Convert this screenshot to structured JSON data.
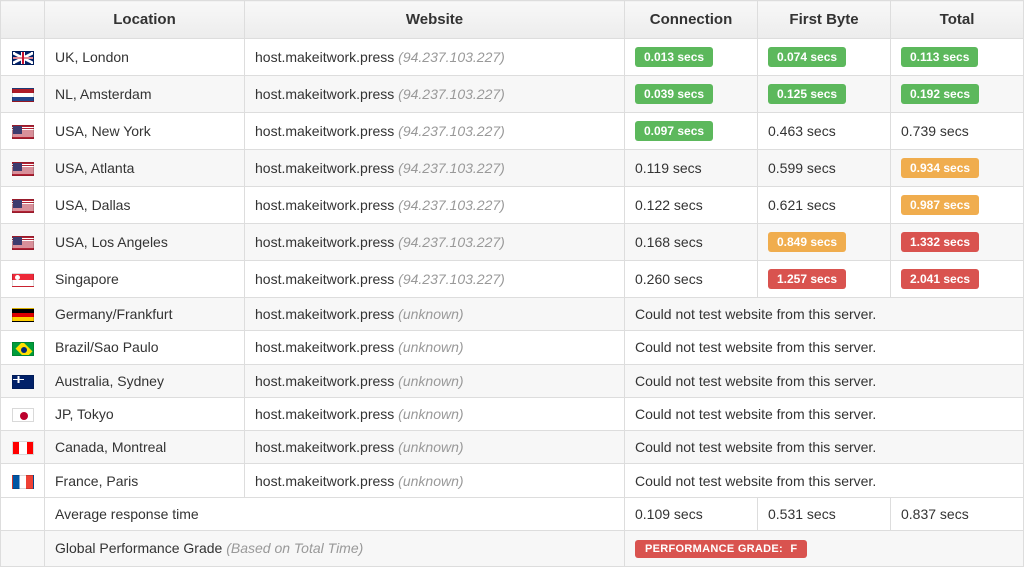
{
  "columns": {
    "flag": "",
    "location": "Location",
    "website": "Website",
    "connection": "Connection",
    "first_byte": "First Byte",
    "total": "Total"
  },
  "host": "host.makeitwork.press",
  "ip_known": "(94.237.103.227)",
  "ip_unknown": "(unknown)",
  "error_text": "Could not test website from this server.",
  "rows": [
    {
      "flag": "uk",
      "location": "UK, London",
      "ip": "known",
      "conn": {
        "v": "0.013 secs",
        "c": "green"
      },
      "fb": {
        "v": "0.074 secs",
        "c": "green"
      },
      "tot": {
        "v": "0.113 secs",
        "c": "green"
      }
    },
    {
      "flag": "nl",
      "location": "NL, Amsterdam",
      "ip": "known",
      "conn": {
        "v": "0.039 secs",
        "c": "green"
      },
      "fb": {
        "v": "0.125 secs",
        "c": "green"
      },
      "tot": {
        "v": "0.192 secs",
        "c": "green"
      }
    },
    {
      "flag": "us",
      "location": "USA, New York",
      "ip": "known",
      "conn": {
        "v": "0.097 secs",
        "c": "green"
      },
      "fb": {
        "v": "0.463 secs",
        "c": "plain"
      },
      "tot": {
        "v": "0.739 secs",
        "c": "plain"
      }
    },
    {
      "flag": "us",
      "location": "USA, Atlanta",
      "ip": "known",
      "conn": {
        "v": "0.119 secs",
        "c": "plain"
      },
      "fb": {
        "v": "0.599 secs",
        "c": "plain"
      },
      "tot": {
        "v": "0.934 secs",
        "c": "orange"
      }
    },
    {
      "flag": "us",
      "location": "USA, Dallas",
      "ip": "known",
      "conn": {
        "v": "0.122 secs",
        "c": "plain"
      },
      "fb": {
        "v": "0.621 secs",
        "c": "plain"
      },
      "tot": {
        "v": "0.987 secs",
        "c": "orange"
      }
    },
    {
      "flag": "us",
      "location": "USA, Los Angeles",
      "ip": "known",
      "conn": {
        "v": "0.168 secs",
        "c": "plain"
      },
      "fb": {
        "v": "0.849 secs",
        "c": "orange"
      },
      "tot": {
        "v": "1.332 secs",
        "c": "red"
      }
    },
    {
      "flag": "sg",
      "location": "Singapore",
      "ip": "known",
      "conn": {
        "v": "0.260 secs",
        "c": "plain"
      },
      "fb": {
        "v": "1.257 secs",
        "c": "red"
      },
      "tot": {
        "v": "2.041 secs",
        "c": "red"
      }
    },
    {
      "flag": "de",
      "location": "Germany/Frankfurt",
      "ip": "unknown",
      "error": true
    },
    {
      "flag": "br",
      "location": "Brazil/Sao Paulo",
      "ip": "unknown",
      "error": true
    },
    {
      "flag": "au",
      "location": "Australia, Sydney",
      "ip": "unknown",
      "error": true
    },
    {
      "flag": "jp",
      "location": "JP, Tokyo",
      "ip": "unknown",
      "error": true
    },
    {
      "flag": "ca",
      "location": "Canada, Montreal",
      "ip": "unknown",
      "error": true
    },
    {
      "flag": "fr",
      "location": "France, Paris",
      "ip": "unknown",
      "error": true
    }
  ],
  "summary": {
    "avg_label": "Average response time",
    "avg_conn": "0.109 secs",
    "avg_fb": "0.531 secs",
    "avg_tot": "0.837 secs",
    "grade_label": "Global Performance Grade",
    "grade_sub": "(Based on Total Time)",
    "grade_prefix": "PERFORMANCE GRADE:",
    "grade_letter": "F"
  }
}
